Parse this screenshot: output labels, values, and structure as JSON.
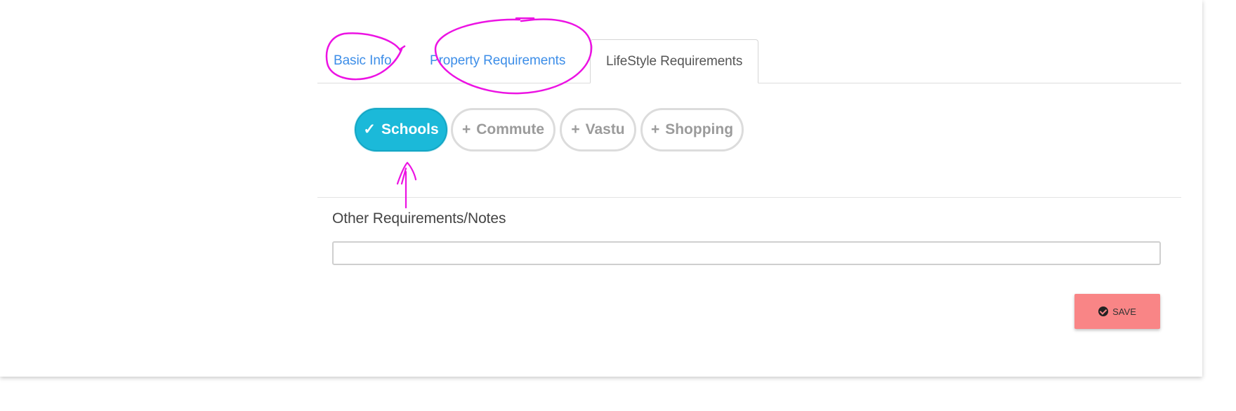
{
  "tabs": {
    "items": [
      {
        "label": "Basic Info"
      },
      {
        "label": "Property Requirements"
      },
      {
        "label": "LifeStyle Requirements"
      }
    ]
  },
  "pills": {
    "items": [
      {
        "label": "Schools",
        "state": "selected",
        "icon": "check-icon"
      },
      {
        "label": "Commute",
        "state": "unselected",
        "icon": "plus-icon"
      },
      {
        "label": "Vastu",
        "state": "unselected",
        "icon": "plus-icon"
      },
      {
        "label": "Shopping",
        "state": "unselected",
        "icon": "plus-icon"
      }
    ]
  },
  "notes": {
    "label": "Other Requirements/Notes",
    "value": ""
  },
  "actions": {
    "save_label": "SAVE",
    "save_icon": "check-circle-icon"
  },
  "colors": {
    "accent": "#1bb9d9",
    "link": "#3d8ee8",
    "save": "#f98586",
    "annotation": "#ec13e3"
  }
}
